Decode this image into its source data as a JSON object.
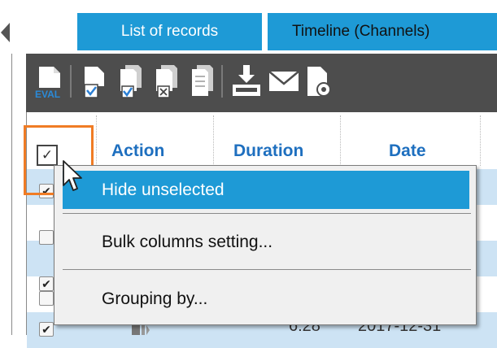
{
  "tabs": [
    {
      "label": "List of records"
    },
    {
      "label": "Timeline (Channels)"
    }
  ],
  "toolbar": {
    "icons": [
      "eval-icon",
      "check-document-icon",
      "documents-icon",
      "documents-check-icon",
      "documents-x-icon",
      "documents-icon",
      "download-tray-icon",
      "envelope-icon",
      "document-settings-icon"
    ],
    "eval_text": "EVAL"
  },
  "columns": {
    "action": "Action",
    "duration": "Duration",
    "date": "Date"
  },
  "header_checkbox": {
    "glyph": "✓"
  },
  "rows": [
    {
      "checked": true,
      "glyph": "✔"
    },
    {
      "checked": false,
      "glyph": ""
    },
    {
      "checked": true,
      "glyph": "✔"
    },
    {
      "checked": false,
      "glyph": ""
    },
    {
      "checked": true,
      "glyph": "✔",
      "duration": "6:28",
      "date": "2017-12-31"
    }
  ],
  "context_menu": {
    "items": [
      {
        "label": "Hide unselected",
        "selected": true
      },
      {
        "label": "Bulk columns setting..."
      },
      {
        "label": "Grouping by..."
      }
    ]
  },
  "colors": {
    "accent": "#1e9ad6",
    "toolbar": "#4d4d4d",
    "highlight": "#f07c25",
    "row_selected": "#cde3f4",
    "column_header": "#1e6fbf"
  }
}
